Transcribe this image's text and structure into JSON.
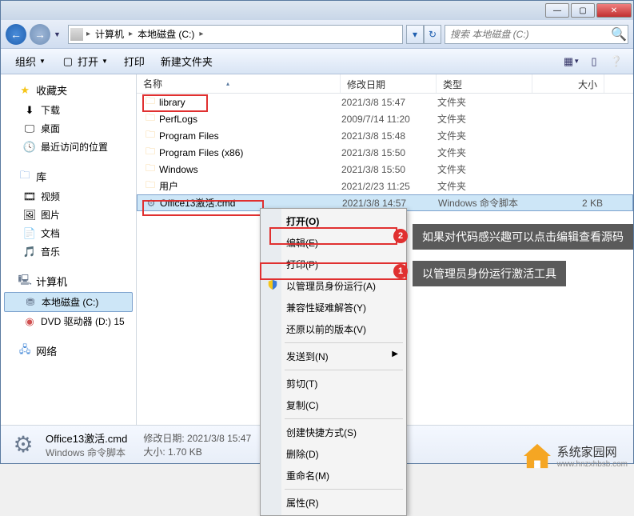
{
  "titlebar": {
    "min": "—",
    "max": "▢",
    "close": "✕"
  },
  "nav": {
    "back": "←",
    "forward": "→"
  },
  "breadcrumb": {
    "computer": "计算机",
    "drive": "本地磁盘 (C:)"
  },
  "search": {
    "placeholder": "搜索 本地磁盘 (C:)"
  },
  "toolbar": {
    "organize": "组织",
    "open": "打开",
    "print": "打印",
    "newfolder": "新建文件夹"
  },
  "sidebar": {
    "favorites": {
      "label": "收藏夹",
      "items": [
        "下载",
        "桌面",
        "最近访问的位置"
      ]
    },
    "libraries": {
      "label": "库",
      "items": [
        "视频",
        "图片",
        "文档",
        "音乐"
      ]
    },
    "computer": {
      "label": "计算机",
      "items": [
        "本地磁盘 (C:)",
        "DVD 驱动器 (D:) 15"
      ]
    },
    "network": {
      "label": "网络"
    }
  },
  "columns": {
    "name": "名称",
    "date": "修改日期",
    "type": "类型",
    "size": "大小"
  },
  "files": [
    {
      "name": "library",
      "date": "2021/3/8 15:47",
      "type": "文件夹",
      "size": "",
      "icon": "folder"
    },
    {
      "name": "PerfLogs",
      "date": "2009/7/14 11:20",
      "type": "文件夹",
      "size": "",
      "icon": "folder"
    },
    {
      "name": "Program Files",
      "date": "2021/3/8 15:48",
      "type": "文件夹",
      "size": "",
      "icon": "folder"
    },
    {
      "name": "Program Files (x86)",
      "date": "2021/3/8 15:50",
      "type": "文件夹",
      "size": "",
      "icon": "folder"
    },
    {
      "name": "Windows",
      "date": "2021/3/8 15:50",
      "type": "文件夹",
      "size": "",
      "icon": "folder"
    },
    {
      "name": "用户",
      "date": "2021/2/23 11:25",
      "type": "文件夹",
      "size": "",
      "icon": "folder"
    },
    {
      "name": "Office13激活.cmd",
      "date": "2021/3/8 14:57",
      "type": "Windows 命令脚本",
      "size": "2 KB",
      "icon": "cmd",
      "sel": true
    }
  ],
  "context": {
    "open": "打开(O)",
    "edit": "编辑(E)",
    "print": "打印(P)",
    "runas": "以管理员身份运行(A)",
    "compat": "兼容性疑难解答(Y)",
    "restore": "还原以前的版本(V)",
    "sendto": "发送到(N)",
    "cut": "剪切(T)",
    "copy": "复制(C)",
    "shortcut": "创建快捷方式(S)",
    "delete": "删除(D)",
    "rename": "重命名(M)",
    "properties": "属性(R)"
  },
  "callouts": {
    "c1": "如果对代码感兴趣可以点击编辑查看源码",
    "c2": "以管理员身份运行激活工具",
    "badge1": "1",
    "badge2": "2"
  },
  "details": {
    "filename": "Office13激活.cmd",
    "filetype": "Windows 命令脚本",
    "datelabel": "修改日期:",
    "date": "2021/3/8 15:47",
    "sizelabel": "大小:",
    "size": "1.70 KB"
  },
  "watermark": {
    "title": "系统家园网",
    "url": "www.hnzxhbsb.com"
  }
}
